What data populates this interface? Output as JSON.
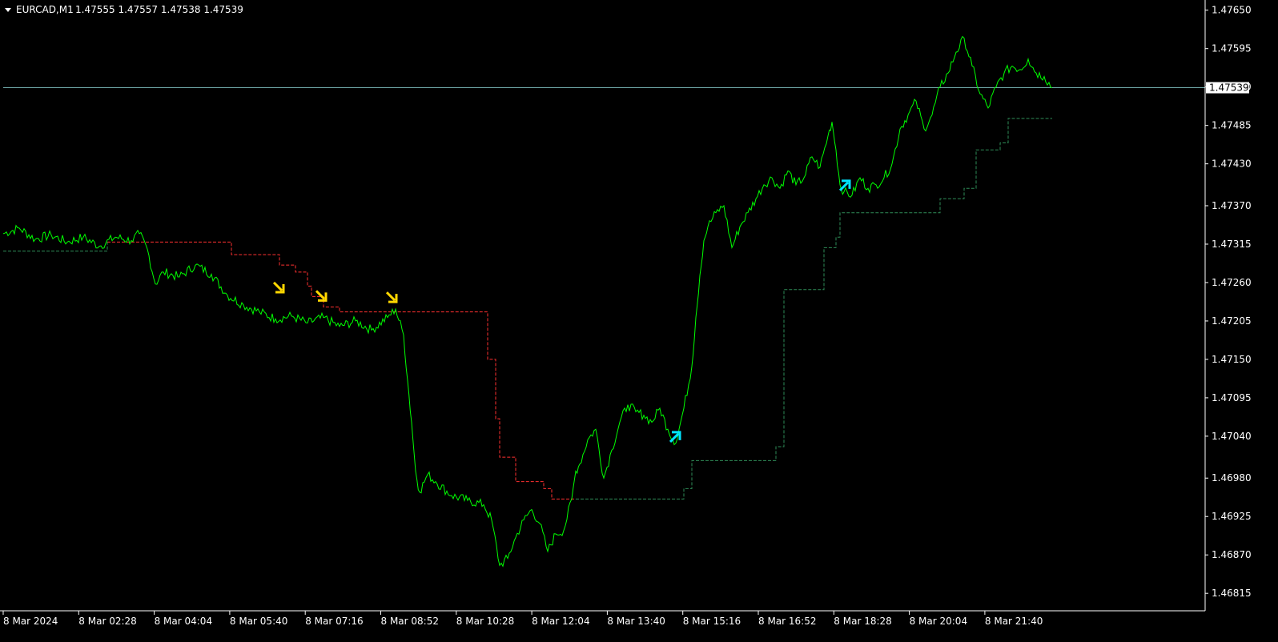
{
  "header": {
    "symbol": "EURCAD,M1",
    "ohlc": "1.47555 1.47557 1.47538 1.47539"
  },
  "current_price_label": "1.47539",
  "colors": {
    "background": "#000000",
    "axis": "#ffffff",
    "price_line": "#00ff00",
    "sell_stop": "#ff3030",
    "buy_stop": "#2e8b57",
    "bid_line": "#6fa8a8",
    "sell_arrow": "#ffd700",
    "buy_arrow": "#00e5ff",
    "price_tag_bg": "#ffffff",
    "price_tag_text": "#000000"
  },
  "chart_data": {
    "type": "line",
    "y_ticks": [
      "1.47650",
      "1.47595",
      "1.47540",
      "1.47485",
      "1.47430",
      "1.47370",
      "1.47315",
      "1.47260",
      "1.47205",
      "1.47150",
      "1.47095",
      "1.47040",
      "1.46980",
      "1.46925",
      "1.46870",
      "1.46815"
    ],
    "ylim": [
      1.4679,
      1.4766
    ],
    "x_ticks": [
      "8 Mar 2024",
      "8 Mar 02:28",
      "8 Mar 04:04",
      "8 Mar 05:40",
      "8 Mar 07:16",
      "8 Mar 08:52",
      "8 Mar 10:28",
      "8 Mar 12:04",
      "8 Mar 13:40",
      "8 Mar 15:16",
      "8 Mar 16:52",
      "8 Mar 18:28",
      "8 Mar 20:04",
      "8 Mar 21:40"
    ],
    "current_price": 1.47539,
    "series": [
      {
        "x": [
          0,
          20,
          40,
          60,
          80,
          100,
          120,
          140,
          160,
          170,
          180,
          190,
          200,
          220,
          240,
          260,
          280,
          300,
          320,
          340,
          360,
          380,
          400,
          420,
          440,
          460,
          480,
          490,
          500,
          505,
          510,
          515,
          520,
          530,
          540,
          560,
          580,
          600,
          610,
          620,
          630,
          640,
          650,
          660,
          670,
          680,
          690,
          700,
          710,
          715,
          720,
          730,
          740,
          750,
          760,
          770,
          780,
          790,
          800,
          810,
          820,
          830,
          840,
          850,
          860,
          865,
          870,
          875,
          880,
          890,
          900,
          910,
          920,
          930,
          940,
          950,
          960,
          970,
          980,
          990,
          1000,
          1010,
          1020,
          1030,
          1035,
          1040,
          1045,
          1050,
          1060,
          1070,
          1080,
          1090,
          1100,
          1110,
          1120,
          1130,
          1140,
          1150,
          1160,
          1170,
          1180,
          1190,
          1200,
          1210,
          1220,
          1230,
          1240,
          1250,
          1260,
          1270,
          1280,
          1290,
          1300,
          1310
        ],
        "y": [
          1.4733,
          1.47338,
          1.47322,
          1.47328,
          1.47318,
          1.47325,
          1.47312,
          1.47325,
          1.4732,
          1.4733,
          1.47308,
          1.47258,
          1.47275,
          1.47268,
          1.47285,
          1.47272,
          1.47242,
          1.47228,
          1.47218,
          1.47208,
          1.47212,
          1.47202,
          1.4721,
          1.47197,
          1.47205,
          1.47192,
          1.4721,
          1.47222,
          1.47185,
          1.4712,
          1.4706,
          1.4699,
          1.4696,
          1.46985,
          1.46975,
          1.46955,
          1.46948,
          1.46942,
          1.4692,
          1.46855,
          1.46865,
          1.46895,
          1.4692,
          1.46935,
          1.46915,
          1.46875,
          1.469,
          1.46905,
          1.4695,
          1.4699,
          1.47,
          1.47035,
          1.4705,
          1.4698,
          1.4702,
          1.4706,
          1.47085,
          1.47075,
          1.4707,
          1.4706,
          1.4708,
          1.4705,
          1.4703,
          1.4708,
          1.4714,
          1.4721,
          1.4727,
          1.4732,
          1.4734,
          1.4736,
          1.4737,
          1.4731,
          1.4734,
          1.4736,
          1.4738,
          1.474,
          1.4741,
          1.47395,
          1.4742,
          1.474,
          1.4741,
          1.4744,
          1.47425,
          1.4747,
          1.4749,
          1.4745,
          1.474,
          1.4739,
          1.47385,
          1.4741,
          1.47395,
          1.474,
          1.4741,
          1.4743,
          1.4748,
          1.475,
          1.4752,
          1.4748,
          1.475,
          1.4754,
          1.4756,
          1.4759,
          1.4761,
          1.4757,
          1.4753,
          1.4751,
          1.4754,
          1.4756,
          1.4757,
          1.47565,
          1.4758,
          1.4756,
          1.47555,
          1.47539
        ]
      },
      {
        "x": [
          0,
          105,
          110,
          130,
          180,
          280,
          285,
          340,
          345,
          365,
          380,
          385,
          400,
          420,
          600,
          605,
          615,
          620,
          640,
          675,
          685,
          715,
          820,
          850,
          860,
          940,
          965,
          975,
          1020,
          1025,
          1040,
          1045,
          1160,
          1170,
          1200,
          1215,
          1245,
          1255,
          1310
        ],
        "y": [
          1.47305,
          1.47305,
          1.47305,
          1.47318,
          1.47318,
          1.47318,
          1.473,
          1.473,
          1.47285,
          1.47275,
          1.47255,
          1.4724,
          1.47225,
          1.47218,
          1.47218,
          1.4715,
          1.47065,
          1.4701,
          1.46975,
          1.46965,
          1.4695,
          1.4695,
          1.4695,
          1.46965,
          1.47005,
          1.47005,
          1.47025,
          1.4725,
          1.4725,
          1.4731,
          1.47325,
          1.4736,
          1.4736,
          1.4738,
          1.47395,
          1.4745,
          1.4746,
          1.47495,
          1.47495
        ]
      }
    ],
    "sell_stop_range": [
      130,
      715
    ],
    "buy_stop_ranges": [
      [
        0,
        130
      ],
      [
        715,
        1310
      ]
    ],
    "sell_arrows": [
      {
        "x": 345,
        "y": 1.47252
      },
      {
        "x": 398,
        "y": 1.4724
      },
      {
        "x": 486,
        "y": 1.47238
      }
    ],
    "buy_arrows": [
      {
        "x": 840,
        "y": 1.4704
      },
      {
        "x": 1052,
        "y": 1.474
      }
    ]
  }
}
